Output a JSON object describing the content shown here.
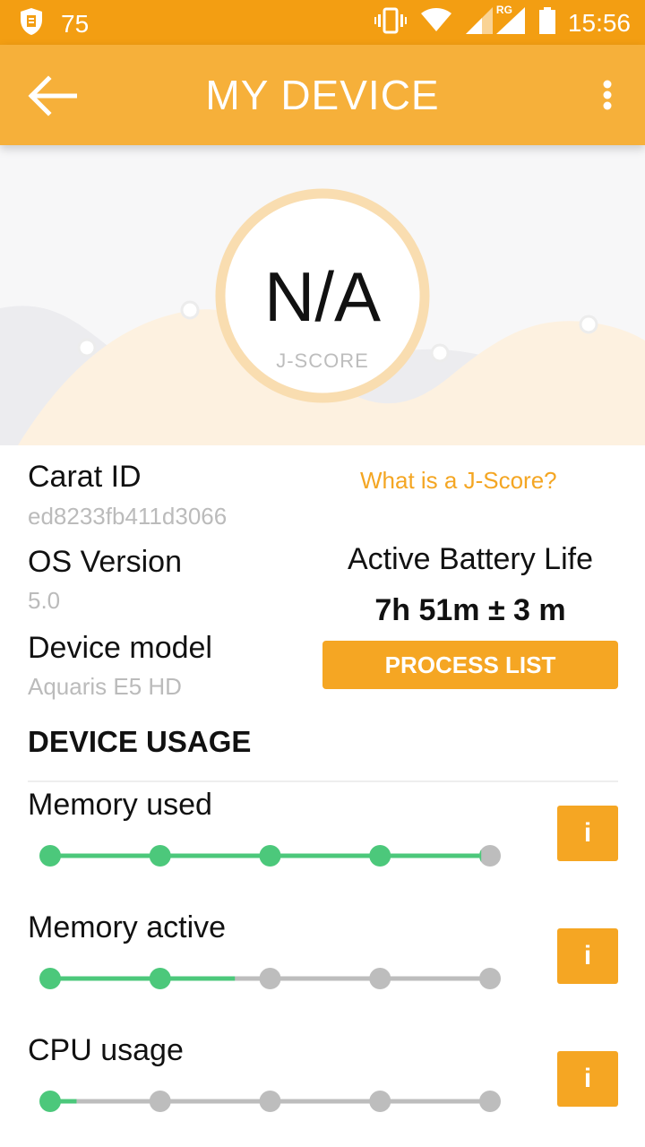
{
  "status_bar": {
    "notification_count": "75",
    "network_label": "RG",
    "time": "15:56"
  },
  "app_bar": {
    "title": "MY DEVICE"
  },
  "score": {
    "value": "N/A",
    "label": "J-SCORE"
  },
  "device": {
    "carat_id_label": "Carat ID",
    "carat_id_value": "ed8233fb411d3066",
    "os_label": "OS Version",
    "os_value": "5.0",
    "model_label": "Device model",
    "model_value": "Aquaris E5 HD"
  },
  "jscore_link": "What is a J-Score?",
  "battery": {
    "title": "Active Battery Life",
    "value": "7h 51m ± 3 m"
  },
  "process_button": "PROCESS LIST",
  "usage": {
    "title": "DEVICE USAGE",
    "info_label": "i",
    "items": [
      {
        "label": "Memory used",
        "level": 0.98
      },
      {
        "label": "Memory active",
        "level": 0.42
      },
      {
        "label": "CPU usage",
        "level": 0.06
      }
    ]
  },
  "colors": {
    "accent": "#F5A623",
    "appbar": "#F6B03A",
    "statusbar": "#F39E12",
    "progress": "#4CC87B",
    "track": "#BDBDBD"
  }
}
